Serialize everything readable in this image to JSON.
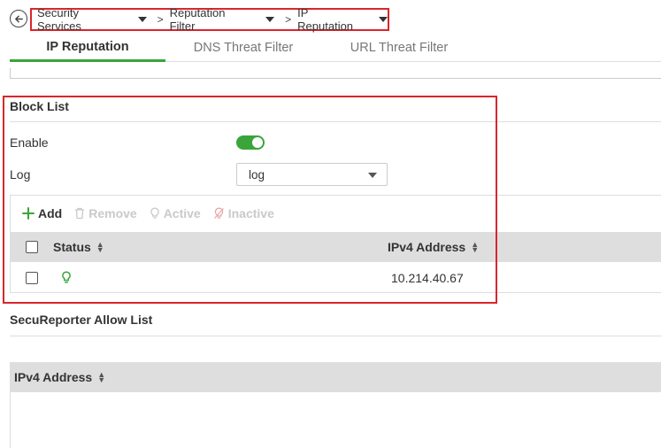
{
  "breadcrumb": {
    "items": [
      "Security Services",
      "Reputation Filter",
      "IP Reputation"
    ],
    "separator": ">"
  },
  "tabs": [
    {
      "label": "IP Reputation",
      "active": true
    },
    {
      "label": "DNS Threat Filter",
      "active": false
    },
    {
      "label": "URL Threat Filter",
      "active": false
    }
  ],
  "block_list": {
    "title": "Block List",
    "enable_label": "Enable",
    "enable_on": true,
    "log_label": "Log",
    "log_value": "log",
    "toolbar": {
      "add": "Add",
      "remove": "Remove",
      "active": "Active",
      "inactive": "Inactive"
    },
    "columns": {
      "status": "Status",
      "ipv4": "IPv4 Address"
    },
    "rows": [
      {
        "status_icon": "bulb-active-icon",
        "ipv4": "10.214.40.67"
      }
    ]
  },
  "allow_list": {
    "title": "SecuReporter Allow List",
    "columns": {
      "ipv4": "IPv4 Address"
    }
  },
  "colors": {
    "accent_green": "#3aa53a",
    "highlight_red": "#d9262b",
    "header_gray": "#dedede"
  }
}
